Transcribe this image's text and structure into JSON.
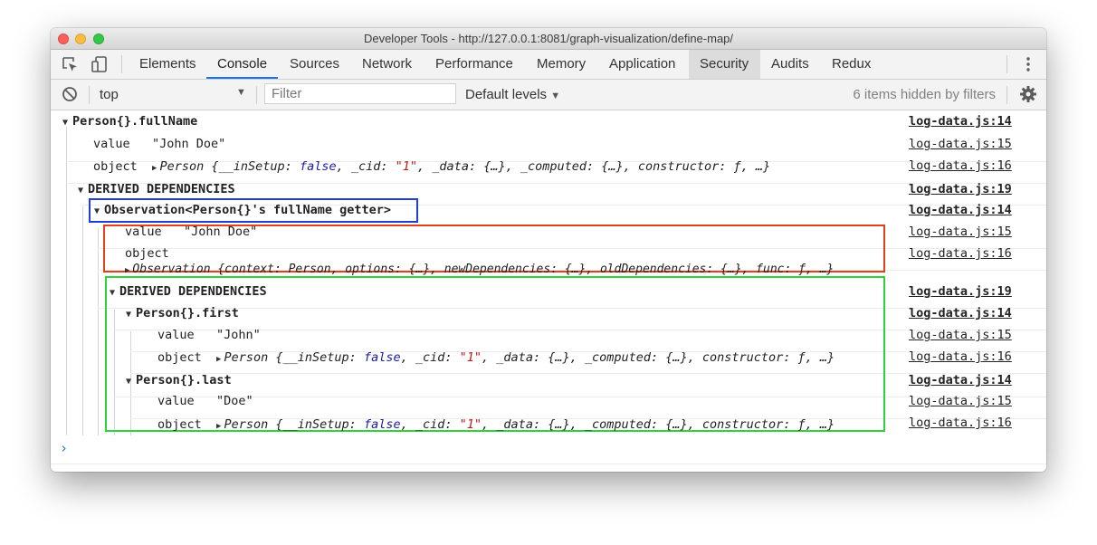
{
  "window": {
    "title": "Developer Tools - http://127.0.0.1:8081/graph-visualization/define-map/"
  },
  "tabs": [
    {
      "label": "Elements"
    },
    {
      "label": "Console"
    },
    {
      "label": "Sources"
    },
    {
      "label": "Network"
    },
    {
      "label": "Performance"
    },
    {
      "label": "Memory"
    },
    {
      "label": "Application"
    },
    {
      "label": "Security"
    },
    {
      "label": "Audits"
    },
    {
      "label": "Redux"
    }
  ],
  "active_tab": "Console",
  "hovered_tab": "Security",
  "filterbar": {
    "context": "top",
    "filter_placeholder": "Filter",
    "filter_value": "",
    "levels": "Default levels",
    "hidden_message": "6 items hidden by filters"
  },
  "console": {
    "group_root": {
      "label": "Person{}.fullName",
      "source": "log-data.js:14"
    },
    "root_value": {
      "key": "value",
      "val": "\"John Doe\"",
      "source": "log-data.js:15"
    },
    "root_object": {
      "key": "object",
      "cls": "Person",
      "open": "{",
      "k_insetup": "__inSetup:",
      "v_insetup": "false",
      "comma1": ",",
      "k_cid": "_cid:",
      "v_cid": "\"1\"",
      "rest": ", _data: {…}, _computed: {…}, constructor: ƒ, …}",
      "source": "log-data.js:16"
    },
    "derived_1": {
      "label": "DERIVED DEPENDENCIES",
      "source": "log-data.js:19"
    },
    "observation": {
      "label": "Observation<Person{}'s fullName getter>",
      "source": "log-data.js:14"
    },
    "obs_value": {
      "key": "value",
      "val": "\"John Doe\"",
      "source": "log-data.js:15"
    },
    "obs_object": {
      "key": "object",
      "preview": "Observation {context: Person, options: {…}, newDependencies: {…}, oldDependencies: {…}, func: ƒ, …}",
      "source": "log-data.js:16"
    },
    "derived_2": {
      "label": "DERIVED DEPENDENCIES",
      "source": "log-data.js:19"
    },
    "first": {
      "label": "Person{}.first",
      "source": "log-data.js:14"
    },
    "first_value": {
      "key": "value",
      "val": "\"John\"",
      "source": "log-data.js:15"
    },
    "first_object": {
      "key": "object",
      "cls": "Person",
      "open": "{",
      "k_insetup": "__inSetup:",
      "v_insetup": "false",
      "comma1": ",",
      "k_cid": "_cid:",
      "v_cid": "\"1\"",
      "rest": ", _data: {…}, _computed: {…}, constructor: ƒ, …}",
      "source": "log-data.js:16"
    },
    "last": {
      "label": "Person{}.last",
      "source": "log-data.js:14"
    },
    "last_value": {
      "key": "value",
      "val": "\"Doe\"",
      "source": "log-data.js:15"
    },
    "last_object": {
      "key": "object",
      "cls": "Person",
      "open": "{",
      "k_insetup": "__inSetup:",
      "v_insetup": "false",
      "comma1": ",",
      "k_cid": "_cid:",
      "v_cid": "\"1\"",
      "rest": ", _data: {…}, _computed: {…}, constructor: ƒ, …}",
      "source": "log-data.js:16"
    },
    "prompt": "›"
  },
  "colors": {
    "active_tab_underline": "#1a73e8",
    "highlight_blue": "#1f3fd1",
    "highlight_red": "#e0401a",
    "highlight_green": "#2fd23a",
    "keyword": "#1a1aa6",
    "string": "#c41a16"
  },
  "icons": [
    "inspect-element-icon",
    "device-toolbar-icon",
    "clear-console-icon",
    "dropdown-arrow-icon",
    "kebab-menu-icon",
    "settings-gear-icon",
    "expand-triangle-icon",
    "collapse-triangle-icon"
  ]
}
